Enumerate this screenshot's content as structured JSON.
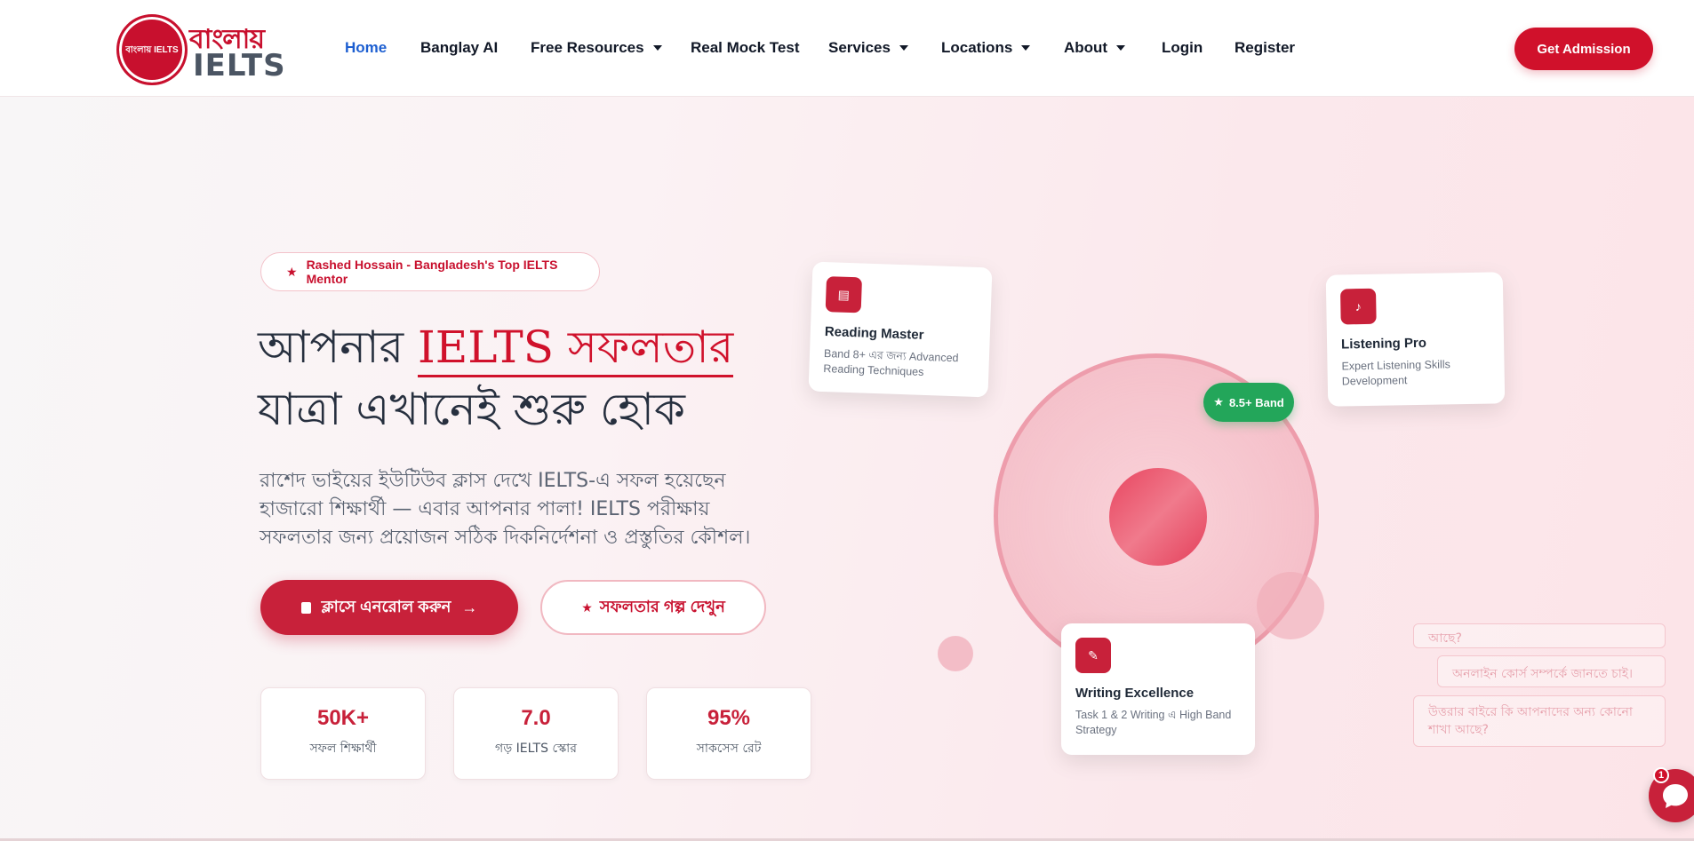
{
  "logo": {
    "badge_text": "বাংলায় IELTS",
    "text_top": "বাংলায়",
    "text_bottom": "IELTS"
  },
  "nav": {
    "items": [
      {
        "label": "Home",
        "active": true,
        "dropdown": false
      },
      {
        "label": "Banglay AI",
        "dropdown": false
      },
      {
        "label": "Free Resources",
        "dropdown": true
      },
      {
        "label": "Real Mock Test",
        "dropdown": false
      },
      {
        "label": "Services",
        "dropdown": true
      },
      {
        "label": "Locations",
        "dropdown": true
      },
      {
        "label": "About",
        "dropdown": true
      },
      {
        "label": "Login",
        "dropdown": false
      },
      {
        "label": "Register",
        "dropdown": false
      }
    ],
    "cta_label": "Get Admission"
  },
  "hero": {
    "pill_text": "Rashed Hossain - Bangladesh's Top IELTS Mentor",
    "title_part1": "আপনার ",
    "title_accent": "IELTS সফলতার",
    "title_line2": "যাত্রা এখানেই শুরু হোক",
    "subtitle": "রাশেদ ভাইয়ের ইউটিউব ক্লাস দেখে IELTS-এ সফল হয়েছেন হাজারো শিক্ষার্থী — এবার আপনার পালা! IELTS পরীক্ষায় সফলতার জন্য প্রয়োজন সঠিক দিকনির্দেশনা ও প্রস্তুতির কৌশল।",
    "primary_button": "ক্লাসে এনরোল করুন",
    "primary_arrow": "→",
    "secondary_button": "সফলতার গল্প দেখুন",
    "stats": [
      {
        "value": "50K+",
        "label": "সফল শিক্ষার্থী"
      },
      {
        "value": "7.0",
        "label": "গড় IELTS স্কোর"
      },
      {
        "value": "95%",
        "label": "সাকসেস রেট"
      }
    ]
  },
  "cards": {
    "reading": {
      "title": "Reading Master",
      "desc": "Band 8+ এর জন্য Advanced Reading Techniques"
    },
    "listening": {
      "title": "Listening Pro",
      "desc": "Expert Listening Skills Development"
    },
    "writing": {
      "title": "Writing Excellence",
      "desc": "Task 1 & 2 Writing এ High Band Strategy"
    },
    "band_badge": "8.5+ Band"
  },
  "faq": {
    "items": [
      "আছে?",
      "অনলাইন কোর্স সম্পর্কে জানতে চাই।",
      "উত্তরার বাইরে কি আপনাদের অন্য কোনো শাখা আছে?"
    ]
  },
  "chat": {
    "badge_count": "1"
  },
  "colors": {
    "brand": "#c8102e",
    "nav_active": "#1d5fd1",
    "band_green": "#23a65a"
  }
}
